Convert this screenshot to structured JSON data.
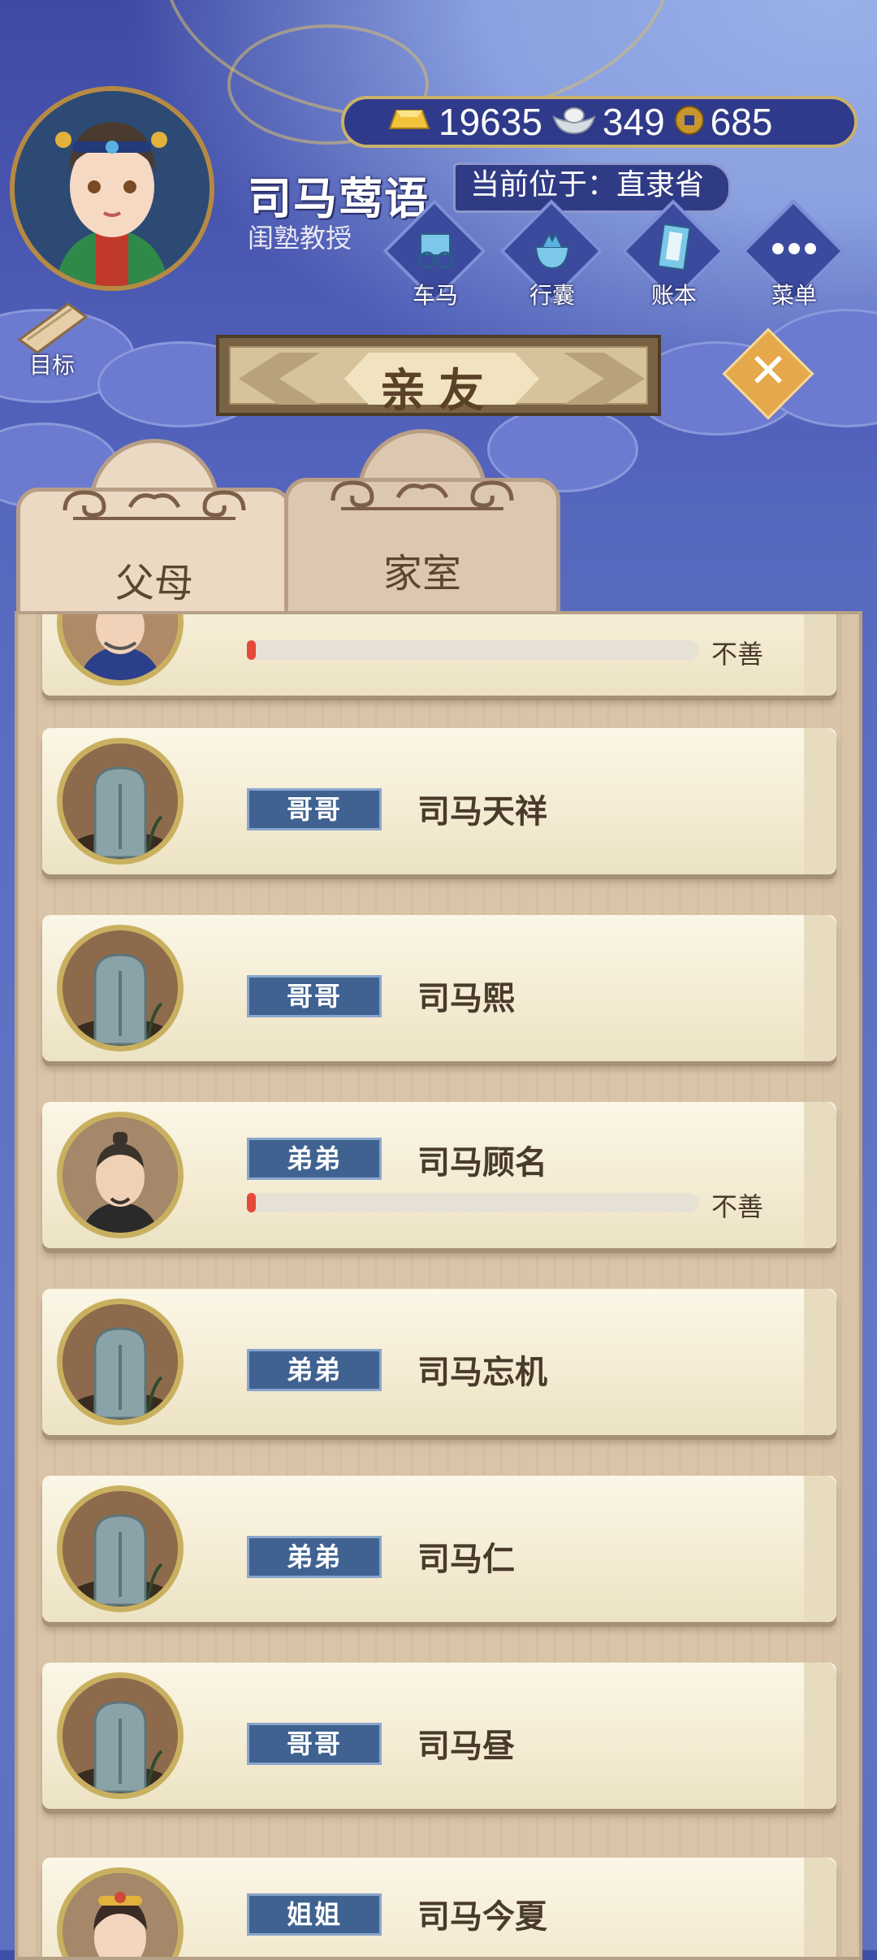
{
  "player": {
    "name": "司马莺语",
    "title": "闺塾教授"
  },
  "currency": {
    "gold": "19635",
    "silver": "349",
    "coins": "685"
  },
  "location": "当前位于：直隶省",
  "menu": [
    {
      "label": "车马",
      "icon": "carriage-icon"
    },
    {
      "label": "行囊",
      "icon": "bag-icon"
    },
    {
      "label": "账本",
      "icon": "ledger-icon"
    },
    {
      "label": "菜单",
      "icon": "menu-dots-icon"
    }
  ],
  "goal_label": "目标",
  "panel_title": "亲友",
  "tabs": [
    {
      "label": "父母",
      "active": true
    },
    {
      "label": "家室",
      "active": false
    }
  ],
  "relatives": [
    {
      "relation": "",
      "name": "",
      "favor": 0.02,
      "favor_label": "不善",
      "portrait": "official-portrait-icon",
      "alive": true
    },
    {
      "relation": "哥哥",
      "name": "司马天祥",
      "portrait": "tombstone-icon",
      "alive": false
    },
    {
      "relation": "哥哥",
      "name": "司马熙",
      "portrait": "tombstone-icon",
      "alive": false
    },
    {
      "relation": "弟弟",
      "name": "司马顾名",
      "favor": 0.02,
      "favor_label": "不善",
      "portrait": "man-portrait-icon",
      "alive": true
    },
    {
      "relation": "弟弟",
      "name": "司马忘机",
      "portrait": "tombstone-icon",
      "alive": false
    },
    {
      "relation": "弟弟",
      "name": "司马仁",
      "portrait": "tombstone-icon",
      "alive": false
    },
    {
      "relation": "哥哥",
      "name": "司马昼",
      "portrait": "tombstone-icon",
      "alive": false
    },
    {
      "relation": "姐姐",
      "name": "司马今夏",
      "portrait": "woman-portrait-icon",
      "alive": true
    }
  ],
  "colors": {
    "accent": "#3f6291",
    "favor_bar": "#e34a3a",
    "gold_border": "#c9b26a"
  }
}
